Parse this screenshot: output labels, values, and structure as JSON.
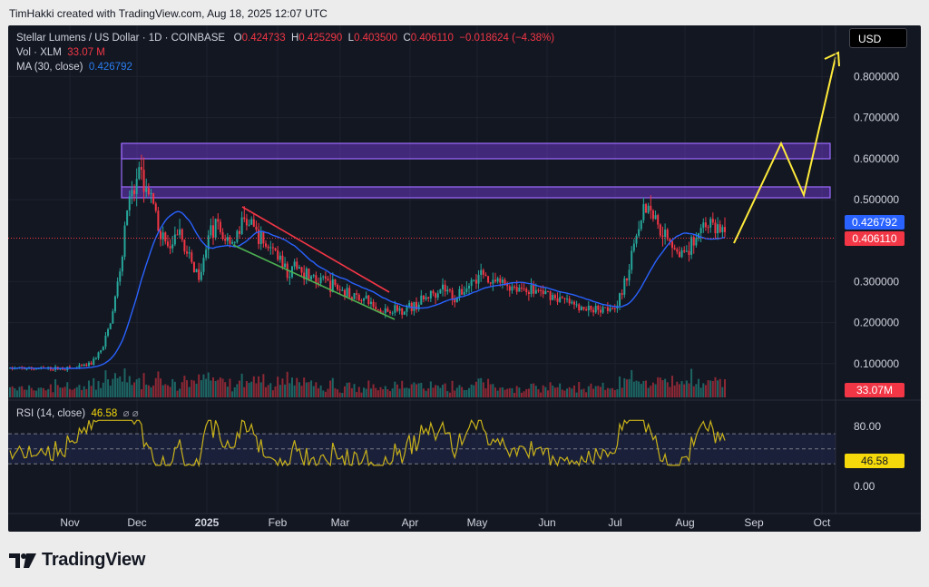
{
  "header": {
    "attribution": "TimHakki created with TradingView.com, Aug 18, 2025 12:07 UTC"
  },
  "legend": {
    "symbol": "Stellar Lumens / US Dollar · 1D · COINBASE",
    "o_label": "O",
    "o_val": "0.424733",
    "h_label": "H",
    "h_val": "0.425290",
    "l_label": "L",
    "l_val": "0.403500",
    "c_label": "C",
    "c_val": "0.406110",
    "change": "−0.018624 (−4.38%)",
    "vol_label": "Vol · XLM",
    "vol_val": "33.07 M",
    "ma_label": "MA (30, close)",
    "ma_val": "0.426792",
    "rsi_label": "RSI (14, close)",
    "rsi_val": "46.58",
    "rsi_icons": "⌀ ⌀"
  },
  "currency_button": "USD",
  "price_axis": [
    "0.800000",
    "0.700000",
    "0.600000",
    "0.500000",
    "0.300000",
    "0.200000",
    "0.100000"
  ],
  "price_axis_values": [
    0.8,
    0.7,
    0.6,
    0.5,
    0.3,
    0.2,
    0.1
  ],
  "badges": {
    "ma": "0.426792",
    "close": "0.406110",
    "volume": "33.07M",
    "rsi": "46.58"
  },
  "rsi_axis": [
    "80.00",
    "0.00"
  ],
  "rsi_axis_values": [
    80,
    0
  ],
  "time_axis": [
    "Nov",
    "Dec",
    "2025",
    "Feb",
    "Mar",
    "Apr",
    "May",
    "Jun",
    "Jul",
    "Aug",
    "Sep",
    "Oct"
  ],
  "colors": {
    "up": "#26a69a",
    "down": "#f23645",
    "ma": "#2962ff",
    "zone": "#7b3fe4",
    "projection": "#ffeb3b",
    "rsi": "#c9b21a"
  },
  "brand": "TradingView"
}
